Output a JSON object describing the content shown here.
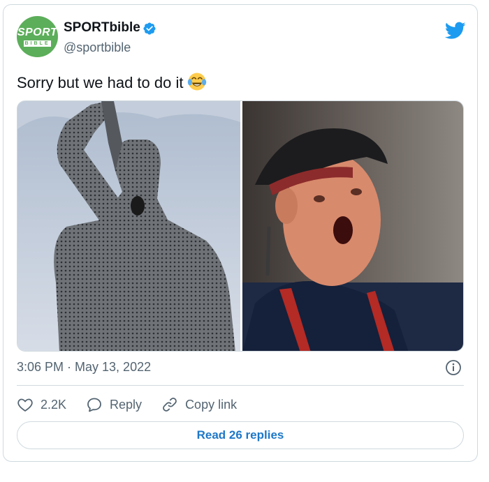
{
  "account": {
    "display_name": "SPORTbible",
    "handle": "@sportbible",
    "avatar_text_top": "SPORT",
    "avatar_text_bottom": "BIBLE",
    "verified": true
  },
  "tweet": {
    "text": "Sorry but we had to do it",
    "emoji": "face-with-tears-of-joy",
    "timestamp": "3:06 PM · May 13, 2022"
  },
  "actions": {
    "like_count": "2.2K",
    "reply_label": "Reply",
    "copy_link_label": "Copy link"
  },
  "read_replies_label": "Read 26 replies",
  "colors": {
    "twitter_blue": "#1d9bf0",
    "link_blue": "#1d78c8",
    "secondary_text": "#536471",
    "border": "#cfd9de",
    "avatar_green": "#5cae5a"
  }
}
